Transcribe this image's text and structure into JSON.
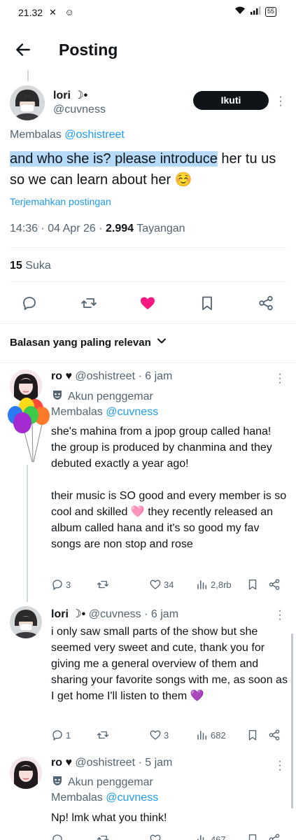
{
  "status_bar": {
    "time": "21.32",
    "battery": "55"
  },
  "header": {
    "title": "Posting"
  },
  "post": {
    "author_name": "lori ☽•",
    "author_handle": "@cuvness",
    "follow_label": "Ikuti",
    "replying_prefix": "Membalas",
    "replying_to": "@oshistreet",
    "text_highlighted": "and who she is? please introduce",
    "text_rest": " her tu us so we can learn about her ☺️",
    "translate_label": "Terjemahkan postingan",
    "timestamp": "14:36 · 04 Apr 26 · ",
    "views_count": "2.994",
    "views_label": " Tayangan",
    "likes_count": "15",
    "likes_label": " Suka"
  },
  "sort_label": "Balasan yang paling relevan",
  "replies": [
    {
      "name": "ro ♥",
      "handle_time": "@oshistreet · 6 jam",
      "badge": "Akun penggemar",
      "replying_prefix": "Membalas",
      "replying_to": "@cuvness",
      "text": "she's mahina from a jpop group called hana! the group is produced by chanmina and they debuted exactly a year ago!\n\ntheir music is SO good and every member is so cool and skilled 🩷 they recently released an album called hana and it's so good my fav songs are non stop and rose",
      "replies_count": "3",
      "retweets_count": "",
      "likes_count": "34",
      "views_count": "2,8rb"
    },
    {
      "name": "lori ☽•",
      "handle_time": "@cuvness · 6 jam",
      "text": "i only saw small parts of the show but she seemed very sweet and cute, thank you for giving me a general overview of them and sharing your favorite songs with me, as soon as I get home I'll listen to them 💜",
      "replies_count": "1",
      "retweets_count": "",
      "likes_count": "3",
      "views_count": "682"
    },
    {
      "name": "ro ♥",
      "handle_time": "@oshistreet · 5 jam",
      "badge": "Akun penggemar",
      "replying_prefix": "Membalas",
      "replying_to": "@cuvness",
      "text": "Np! lmk what you think!",
      "views_count": "467"
    }
  ],
  "colors": {
    "accent": "#1d9bf0",
    "like": "#f91880",
    "text": "#0f1419",
    "muted": "#536471",
    "highlight": "#b7daf8"
  }
}
